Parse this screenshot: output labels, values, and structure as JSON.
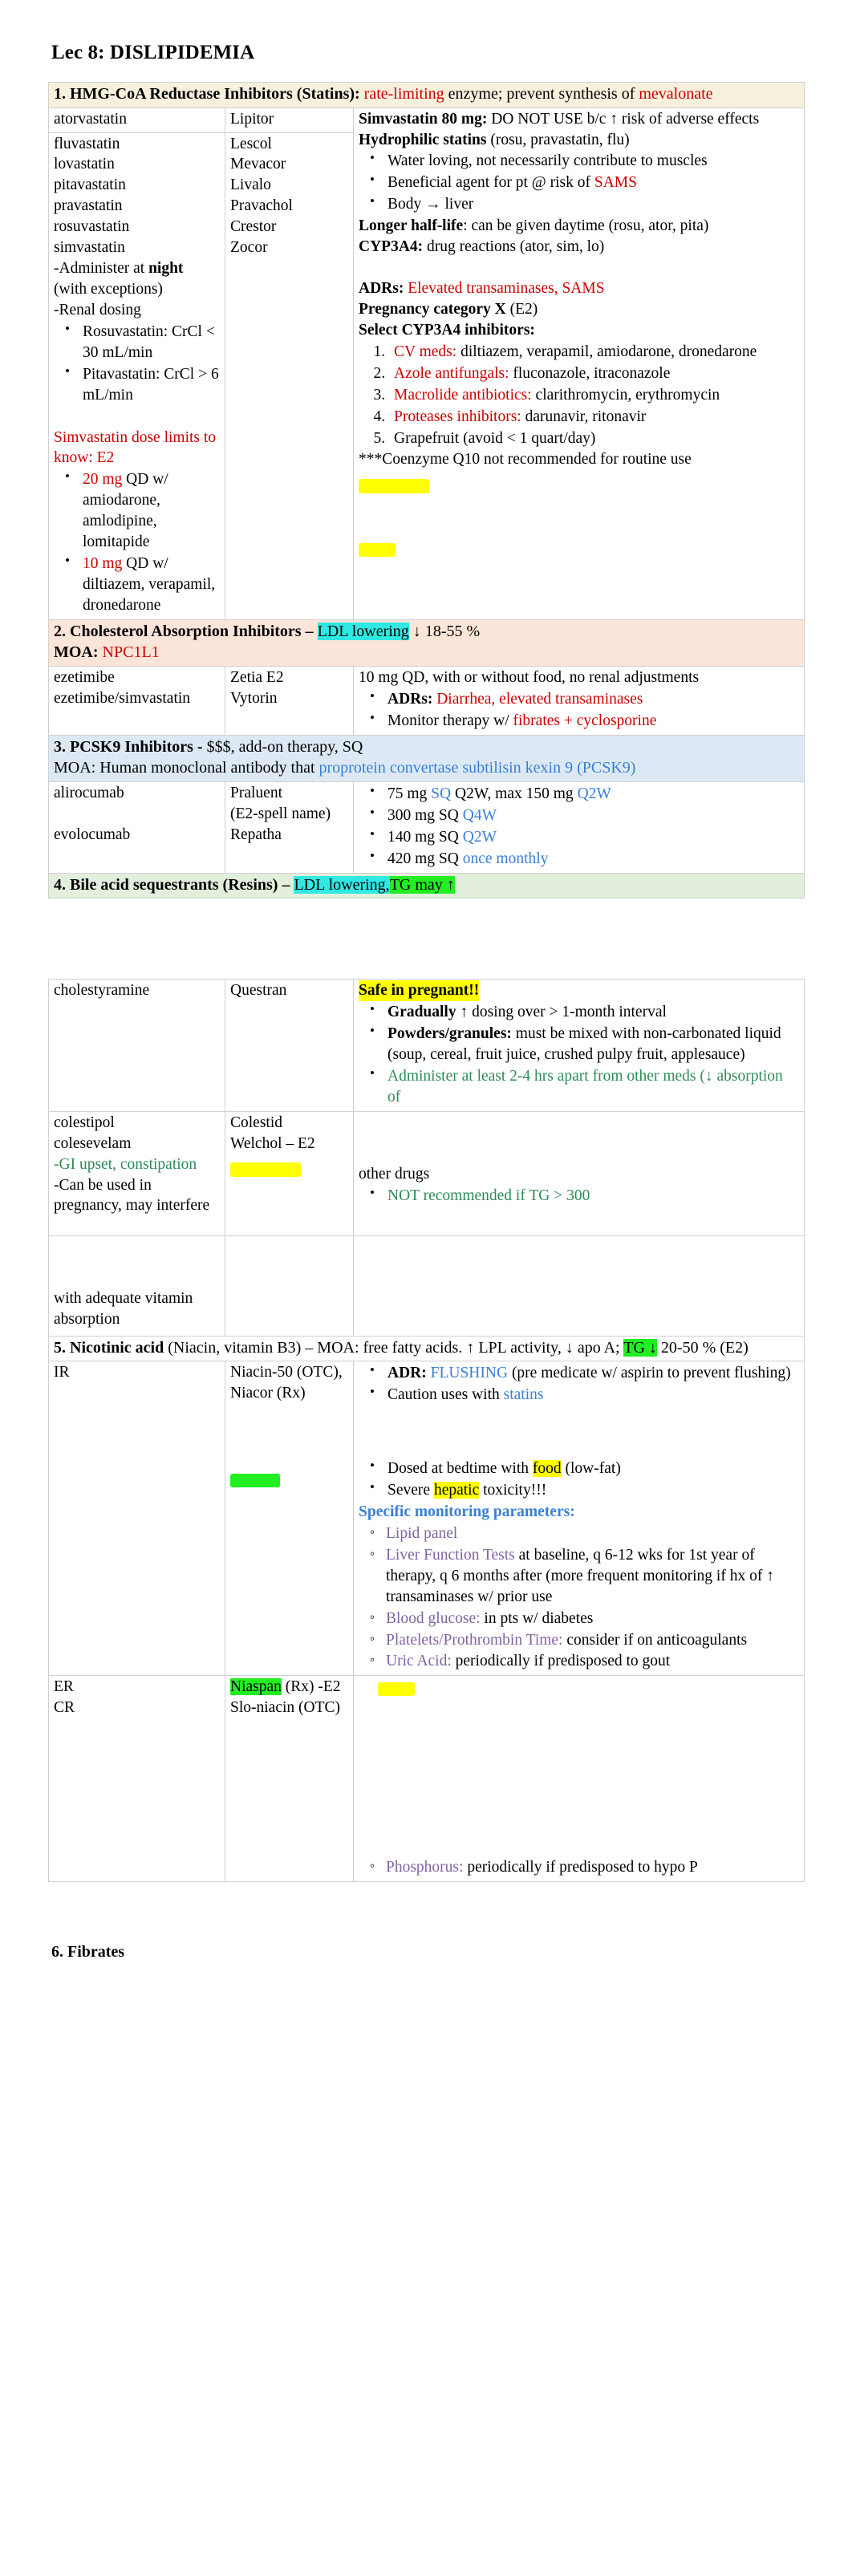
{
  "document": {
    "title": "Lec 8: DISLIPIDEMIA",
    "footer_heading": "6. Fibrates"
  },
  "sections": [
    {
      "id": "statins",
      "number": "1.",
      "heading_main": "1. HMG-CoA Reductase Inhibitors (Statins):",
      "heading_red1": "rate-limiting",
      "heading_mid": "enzyme; prevent synthesis of",
      "heading_red2": "mevalonate",
      "accent": "#f7f0dd"
    },
    {
      "id": "cholesterol-absorption",
      "number": "2.",
      "heading_main": "2. Cholesterol Absorption Inhibitors –",
      "heading_hl": "LDL lowering",
      "heading_tail": "↓ 18-55 %",
      "moa_label": "MOA:",
      "moa_value": "NPC1L1",
      "accent": "#fbe4d8"
    },
    {
      "id": "pcsk9",
      "number": "3.",
      "heading_main": "3. PCSK9 Inhibitors -",
      "heading_tail": "$$$, add-on therapy, SQ",
      "moa_label": "MOA: Human monoclonal antibody that",
      "moa_value": "proprotein convertase subtilisin kexin 9 (PCSK9)",
      "accent": "#dce9f5"
    },
    {
      "id": "bile-acid",
      "number": "4.",
      "heading_main": "4. Bile acid sequestrants (Resins) –",
      "heading_hl1": "LDL lowering,",
      "heading_hl2": "TG may ↑",
      "accent": "#e2efdc"
    },
    {
      "id": "nicotinic-acid",
      "number": "5.",
      "heading_pre": "5. Nicotinic acid",
      "heading_mid": "(Niacin, vitamin B3) – MOA: free fatty acids. ↑ LPL activity, ↓ apo A;",
      "heading_hl": "TG ↓",
      "heading_tail": "20-50 % (E2)",
      "accent": "#ffffff"
    }
  ],
  "statins": {
    "drugs_col1_a": [
      "atorvastatin"
    ],
    "drugs_col2_a": [
      "Lipitor"
    ],
    "right_a": {
      "l1_bold": "Simvastatin 80 mg:",
      "l1_rest": "DO NOT USE b/c ↑ risk of adverse effects",
      "l2_bold": "Hydrophilic statins",
      "l2_rest": "(rosu, pravastatin, flu)",
      "bullets": [
        {
          "text": "Water loving, not necessarily contribute to muscles"
        },
        {
          "pre": "Beneficial agent for pt @ risk of ",
          "red": "SAMS"
        },
        {
          "text": "Body → liver"
        }
      ],
      "l3_bold": "Longer half-life",
      "l3_rest": ": can be given daytime (rosu, ator, pita)",
      "l4_bold": "CYP3A4:",
      "l4_rest": "drug reactions (ator, sim, lo)",
      "adr_bold": "ADRs:",
      "adr_red": "Elevated transaminases, SAMS",
      "preg_bold": "Pregnancy category X",
      "preg_rest": "(E2)",
      "cyp_heading": "Select CYP3A4 inhibitors:",
      "cyp_list": [
        {
          "red": "CV meds:",
          "rest": "diltiazem, verapamil, amiodarone, dronedarone"
        },
        {
          "red": "Azole antifungals:",
          "rest": "fluconazole, itraconazole"
        },
        {
          "red": "Macrolide antibiotics:",
          "rest": "clarithromycin, erythromycin"
        },
        {
          "red": "Proteases inhibitors:",
          "rest": "darunavir, ritonavir"
        },
        {
          "red": "",
          "rest": "Grapefruit (avoid < 1 quart/day)"
        }
      ],
      "coq10": "***Coenzyme Q10 not recommended for routine use"
    },
    "drugs_col1_b": [
      "fluvastatin",
      "lovastatin",
      "pitavastatin",
      "pravastatin",
      "rosuvastatin",
      "simvastatin"
    ],
    "drugs_col2_b": [
      "Lescol",
      "Mevacor",
      "Livalo",
      "Pravachol",
      "Crestor",
      "Zocor"
    ],
    "admin_line_pre": "-Administer at ",
    "admin_line_bold": "night",
    "admin_line_post": " (with exceptions)",
    "renal_line": "-Renal dosing",
    "renal_bullets": [
      "Rosuvastatin: CrCl < 30 mL/min",
      "Pitavastatin: CrCl > 6 mL/min"
    ],
    "simva_heading": "Simvastatin dose limits to know: E2",
    "simva_bullets": [
      {
        "red": "20 mg",
        "rest": " QD w/ amiodarone, amlodipine, lomitapide"
      },
      {
        "red": "10 mg",
        "rest": " QD w/ diltiazem, verapamil, dronedarone"
      }
    ]
  },
  "cholesterol_absorption": {
    "drugs_col1": [
      "ezetimibe",
      "ezetimibe/simvastatin"
    ],
    "drugs_col2": [
      "Zetia E2",
      "Vytorin"
    ],
    "right_line1": "10 mg QD, with or without food, no renal adjustments",
    "bullets": [
      {
        "bold": "ADRs:",
        "red": "Diarrhea, elevated transaminases"
      },
      {
        "pre": "Monitor therapy w/ ",
        "red": "fibrates + cyclosporine"
      }
    ]
  },
  "pcsk9": {
    "drugs_col1": [
      "alirocumab",
      "",
      "evolocumab"
    ],
    "drugs_col2": [
      "Praluent",
      "(E2-spell name)",
      "Repatha"
    ],
    "bullets": [
      {
        "pre": "75 mg ",
        "blue1": "SQ",
        "mid": " Q2W, max 150 mg ",
        "blue2": "Q2W"
      },
      {
        "pre": "300 mg SQ ",
        "blue1": "Q4W",
        "mid": "",
        "blue2": ""
      },
      {
        "pre": "140 mg SQ ",
        "blue1": "Q2W",
        "mid": "",
        "blue2": ""
      },
      {
        "pre": "420 mg SQ ",
        "blue1": "once monthly",
        "mid": "",
        "blue2": ""
      }
    ]
  },
  "bile_acid": {
    "row1_col1": "cholestyramine",
    "row1_col2": "Questran",
    "row1_hl": "Safe in pregnant!!",
    "row1_bullets": [
      {
        "bold": "Gradually",
        "rest": " ↑ dosing over > 1-month interval"
      },
      {
        "bold": "Powders/granules:",
        "rest": " must be mixed with non-carbonated liquid (soup, cereal, fruit juice, crushed pulpy fruit, applesauce)"
      },
      {
        "green": "Administer at least 2-4 hrs apart from other meds (↓ absorption of"
      }
    ],
    "row2_col1": [
      "colestipol",
      "colesevelam"
    ],
    "row2_col2": [
      "Colestid",
      "Welchol – E2"
    ],
    "row2_col1_extra_green": "-GI upset, constipation",
    "row2_col1_extra": "-Can be used in pregnancy, may interfere",
    "row2_right_1": "other drugs",
    "row2_right_green": "NOT recommended if TG > 300",
    "row3_col1": "with adequate vitamin absorption"
  },
  "nicotinic_acid": {
    "rows": [
      {
        "col1": "IR",
        "col2_a": "Niacin-50 (OTC),",
        "col2_b": "Niacor (Rx)"
      },
      {
        "col1": "ER",
        "col2_hl": "Niaspan",
        "col2_rest": " (Rx) -E2"
      },
      {
        "col1": "CR",
        "col2_a": "Slo-niacin (OTC)"
      }
    ],
    "bullets_top": [
      {
        "bold": "ADR:",
        "blue": "FLUSHING",
        "rest": " (pre medicate w/ aspirin to prevent flushing)"
      },
      {
        "pre": "Caution uses with ",
        "blue": "statins"
      }
    ],
    "bullets_mid": [
      {
        "pre": "Dosed at bedtime with ",
        "hl": "food",
        "rest": " (low-fat)"
      },
      {
        "pre": "Severe ",
        "hl": "hepatic",
        "rest": " toxicity!!!"
      }
    ],
    "monitor_heading": "Specific monitoring parameters:",
    "monitor_items": [
      {
        "purple": "Lipid panel",
        "rest": ""
      },
      {
        "purple": "Liver Function Tests",
        "rest": " at baseline, q 6-12 wks for 1st year of therapy, q 6 months after (more frequent monitoring if hx of ↑ transaminases w/ prior use"
      },
      {
        "purple": "Blood glucose:",
        "rest": " in pts w/ diabetes"
      },
      {
        "purple": "Platelets/Prothrombin Time:",
        "rest": " consider if on anticoagulants"
      },
      {
        "purple": "Uric Acid:",
        "rest": " periodically if predisposed to gout"
      },
      {
        "purple": "Phosphorus:",
        "rest": " periodically if predisposed to hypo P"
      }
    ]
  }
}
